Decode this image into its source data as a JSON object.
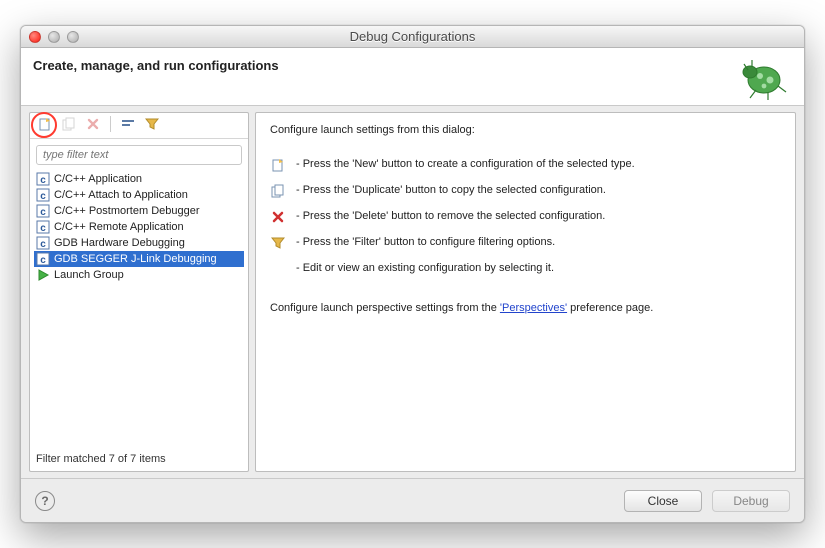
{
  "window": {
    "title": "Debug Configurations"
  },
  "header": {
    "title": "Create, manage, and run configurations"
  },
  "filter": {
    "placeholder": "type filter text"
  },
  "tree": {
    "items": [
      {
        "label": "C/C++ Application",
        "icon": "c"
      },
      {
        "label": "C/C++ Attach to Application",
        "icon": "c"
      },
      {
        "label": "C/C++ Postmortem Debugger",
        "icon": "c"
      },
      {
        "label": "C/C++ Remote Application",
        "icon": "c"
      },
      {
        "label": "GDB Hardware Debugging",
        "icon": "c"
      },
      {
        "label": "GDB SEGGER J-Link Debugging",
        "icon": "c",
        "selected": true
      },
      {
        "label": "Launch Group",
        "icon": "play"
      }
    ],
    "status": "Filter matched 7 of 7 items"
  },
  "tips": {
    "intro": "Configure launch settings from this dialog:",
    "rows": [
      {
        "icon": "new",
        "text": "- Press the 'New' button to create a configuration of the selected type."
      },
      {
        "icon": "duplicate",
        "text": "- Press the 'Duplicate' button to copy the selected configuration."
      },
      {
        "icon": "delete",
        "text": "- Press the 'Delete' button to remove the selected configuration."
      },
      {
        "icon": "filter",
        "text": "- Press the 'Filter' button to configure filtering options."
      },
      {
        "icon": "none",
        "text": "- Edit or view an existing configuration by selecting it."
      }
    ],
    "footer_pre": "Configure launch perspective settings from the ",
    "link": "'Perspectives'",
    "footer_post": " preference page."
  },
  "footer": {
    "close": "Close",
    "debug": "Debug"
  },
  "toolbar": {
    "new": "New launch configuration",
    "duplicate": "Duplicate",
    "delete": "Delete",
    "collapse": "Collapse All",
    "filter": "Filter"
  }
}
